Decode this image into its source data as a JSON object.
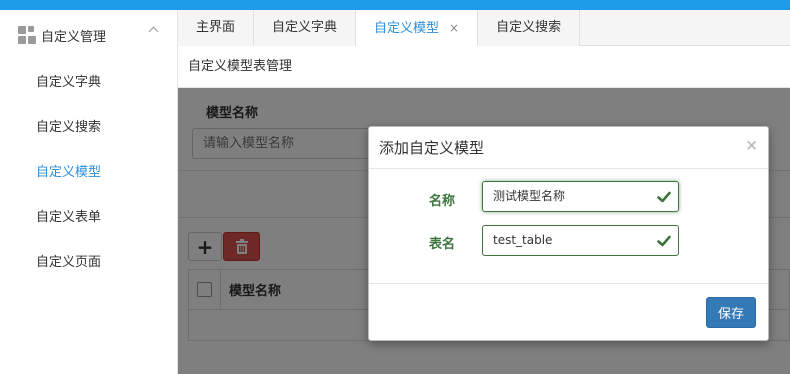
{
  "sidebar": {
    "group_title": "自定义管理",
    "items": [
      {
        "label": "自定义字典"
      },
      {
        "label": "自定义搜索"
      },
      {
        "label": "自定义模型"
      },
      {
        "label": "自定义表单"
      },
      {
        "label": "自定义页面"
      }
    ],
    "active_index": 2
  },
  "tabs": [
    {
      "label": "主界面"
    },
    {
      "label": "自定义字典"
    },
    {
      "label": "自定义模型",
      "close": "×"
    },
    {
      "label": "自定义搜索"
    }
  ],
  "page": {
    "title": "自定义模型表管理",
    "search": {
      "label": "模型名称",
      "placeholder": "请输入模型名称"
    },
    "table": {
      "columns": [
        "模型名称"
      ]
    }
  },
  "modal": {
    "title": "添加自定义模型",
    "close": "×",
    "fields": [
      {
        "label": "名称",
        "value": "测试模型名称"
      },
      {
        "label": "表名",
        "value": "test_table"
      }
    ],
    "save_label": "保存"
  },
  "colors": {
    "accent": "#1e9be8",
    "active_text": "#2d8fd8",
    "success": "#3c763d",
    "danger": "#d9534f",
    "primary": "#337ab7"
  }
}
